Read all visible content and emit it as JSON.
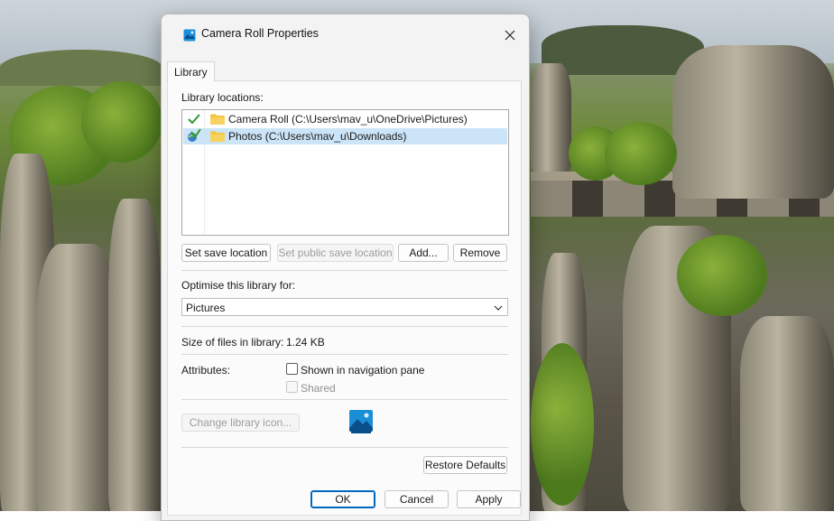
{
  "dialog": {
    "title": "Camera Roll Properties",
    "tab": "Library",
    "library_locations_label": "Library locations:",
    "locations": [
      {
        "status": "check-icon",
        "text": "Camera Roll (C:\\Users\\mav_u\\OneDrive\\Pictures)",
        "selected": false
      },
      {
        "status": "public-save-location-icon",
        "text": "Photos (C:\\Users\\mav_u\\Downloads)",
        "selected": true
      }
    ],
    "buttons": {
      "set_save_location": "Set save location",
      "set_public_save_location": "Set public save location",
      "add": "Add...",
      "remove": "Remove",
      "change_library_icon": "Change library icon...",
      "restore_defaults": "Restore Defaults",
      "ok": "OK",
      "cancel": "Cancel",
      "apply": "Apply"
    },
    "optimise_label": "Optimise this library for:",
    "optimise_value": "Pictures",
    "size_label": "Size of files in library:",
    "size_value": "1.24 KB",
    "attributes_label": "Attributes:",
    "attributes": {
      "shown_in_navigation_pane": {
        "label": "Shown in navigation pane",
        "checked": false,
        "enabled": true
      },
      "shared": {
        "label": "Shared",
        "checked": false,
        "enabled": false
      }
    }
  },
  "colors": {
    "accent": "#0067c0",
    "selection": "#cce4f7",
    "check_green": "#2e9b2e",
    "folder_yellow": "#f4c542"
  }
}
